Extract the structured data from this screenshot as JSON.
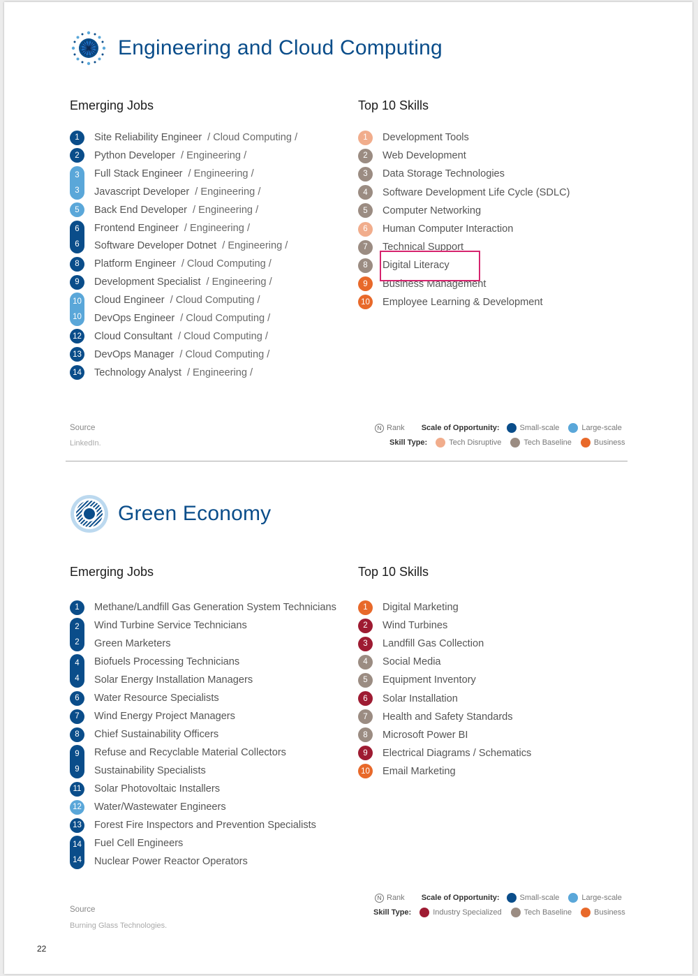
{
  "colors": {
    "title": "#0a4d8a",
    "small_scale": "#0a4d8a",
    "large_scale": "#5aa7d9",
    "tech_disruptive": "#f1ad8c",
    "tech_baseline": "#9b8c82",
    "business": "#e8692a",
    "industry_specialized": "#9e1b32",
    "highlight": "#d6246e"
  },
  "sections": [
    {
      "title": "Engineering and Cloud Computing",
      "icon": "starburst-icon",
      "jobs_heading": "Emerging Jobs",
      "skills_heading": "Top 10 Skills",
      "jobs": [
        {
          "rank": "1",
          "name": "Site Reliability Engineer",
          "category": "/ Cloud Computing /",
          "scale": "small"
        },
        {
          "rank": "2",
          "name": "Python Developer",
          "category": "/ Engineering /",
          "scale": "small"
        },
        {
          "rank": "3",
          "name": "Full Stack Engineer",
          "category": "/ Engineering /",
          "scale": "large"
        },
        {
          "rank": "3",
          "name": "Javascript Developer",
          "category": "/ Engineering /",
          "scale": "large"
        },
        {
          "rank": "5",
          "name": "Back End Developer",
          "category": "/ Engineering /",
          "scale": "large"
        },
        {
          "rank": "6",
          "name": "Frontend Engineer",
          "category": "/ Engineering /",
          "scale": "small"
        },
        {
          "rank": "6",
          "name": "Software Developer Dotnet",
          "category": "/ Engineering /",
          "scale": "small"
        },
        {
          "rank": "8",
          "name": "Platform Engineer",
          "category": "/ Cloud Computing /",
          "scale": "small"
        },
        {
          "rank": "9",
          "name": "Development Specialist",
          "category": "/ Engineering /",
          "scale": "small"
        },
        {
          "rank": "10",
          "name": "Cloud Engineer",
          "category": "/ Cloud Computing /",
          "scale": "large"
        },
        {
          "rank": "10",
          "name": "DevOps Engineer",
          "category": "/ Cloud Computing /",
          "scale": "large"
        },
        {
          "rank": "12",
          "name": "Cloud Consultant",
          "category": "/ Cloud Computing /",
          "scale": "small"
        },
        {
          "rank": "13",
          "name": "DevOps Manager",
          "category": "/ Cloud Computing /",
          "scale": "small"
        },
        {
          "rank": "14",
          "name": "Technology Analyst",
          "category": "/ Engineering /",
          "scale": "small"
        }
      ],
      "skills": [
        {
          "rank": "1",
          "name": "Development Tools",
          "type": "tech_disruptive"
        },
        {
          "rank": "2",
          "name": "Web Development",
          "type": "tech_baseline"
        },
        {
          "rank": "3",
          "name": "Data Storage Technologies",
          "type": "tech_baseline"
        },
        {
          "rank": "4",
          "name": "Software Development Life Cycle (SDLC)",
          "type": "tech_baseline"
        },
        {
          "rank": "5",
          "name": "Computer Networking",
          "type": "tech_baseline"
        },
        {
          "rank": "6",
          "name": "Human Computer Interaction",
          "type": "tech_disruptive"
        },
        {
          "rank": "7",
          "name": "Technical Support",
          "type": "tech_baseline"
        },
        {
          "rank": "8",
          "name": "Digital Literacy",
          "type": "tech_baseline"
        },
        {
          "rank": "9",
          "name": "Business Management",
          "type": "business"
        },
        {
          "rank": "10",
          "name": "Employee Learning & Development",
          "type": "business"
        }
      ],
      "source_label": "Source",
      "source_value": "LinkedIn.",
      "legend": {
        "rank_symbol": "N",
        "rank_label": "Rank",
        "scale_label": "Scale of Opportunity:",
        "small": "Small-scale",
        "large": "Large-scale",
        "skill_type_label": "Skill Type:",
        "types": [
          {
            "label": "Tech Disruptive",
            "color": "#f1ad8c"
          },
          {
            "label": "Tech Baseline",
            "color": "#9b8c82"
          },
          {
            "label": "Business",
            "color": "#e8692a"
          }
        ]
      }
    },
    {
      "title": "Green Economy",
      "icon": "target-icon",
      "jobs_heading": "Emerging Jobs",
      "skills_heading": "Top 10 Skills",
      "jobs": [
        {
          "rank": "1",
          "name": "Methane/Landfill Gas Generation System Technicians",
          "category": "",
          "scale": "small"
        },
        {
          "rank": "2",
          "name": "Wind Turbine Service Technicians",
          "category": "",
          "scale": "small"
        },
        {
          "rank": "2",
          "name": "Green Marketers",
          "category": "",
          "scale": "small"
        },
        {
          "rank": "4",
          "name": "Biofuels Processing Technicians",
          "category": "",
          "scale": "small"
        },
        {
          "rank": "4",
          "name": "Solar Energy Installation Managers",
          "category": "",
          "scale": "small"
        },
        {
          "rank": "6",
          "name": "Water Resource Specialists",
          "category": "",
          "scale": "small"
        },
        {
          "rank": "7",
          "name": "Wind Energy Project Managers",
          "category": "",
          "scale": "small"
        },
        {
          "rank": "8",
          "name": "Chief Sustainability Officers",
          "category": "",
          "scale": "small"
        },
        {
          "rank": "9",
          "name": "Refuse and Recyclable Material Collectors",
          "category": "",
          "scale": "small"
        },
        {
          "rank": "9",
          "name": "Sustainability Specialists",
          "category": "",
          "scale": "small"
        },
        {
          "rank": "11",
          "name": "Solar Photovoltaic Installers",
          "category": "",
          "scale": "small"
        },
        {
          "rank": "12",
          "name": "Water/Wastewater Engineers",
          "category": "",
          "scale": "large"
        },
        {
          "rank": "13",
          "name": "Forest Fire Inspectors and Prevention Specialists",
          "category": "",
          "scale": "small"
        },
        {
          "rank": "14",
          "name": "Fuel Cell Engineers",
          "category": "",
          "scale": "small"
        },
        {
          "rank": "14",
          "name": "Nuclear Power Reactor Operators",
          "category": "",
          "scale": "small"
        }
      ],
      "skills": [
        {
          "rank": "1",
          "name": "Digital Marketing",
          "type": "business"
        },
        {
          "rank": "2",
          "name": "Wind Turbines",
          "type": "industry_specialized"
        },
        {
          "rank": "3",
          "name": "Landfill Gas Collection",
          "type": "industry_specialized"
        },
        {
          "rank": "4",
          "name": "Social Media",
          "type": "tech_baseline"
        },
        {
          "rank": "5",
          "name": "Equipment Inventory",
          "type": "tech_baseline"
        },
        {
          "rank": "6",
          "name": "Solar Installation",
          "type": "industry_specialized"
        },
        {
          "rank": "7",
          "name": "Health and Safety Standards",
          "type": "tech_baseline"
        },
        {
          "rank": "8",
          "name": "Microsoft Power BI",
          "type": "tech_baseline"
        },
        {
          "rank": "9",
          "name": "Electrical Diagrams / Schematics",
          "type": "industry_specialized"
        },
        {
          "rank": "10",
          "name": "Email Marketing",
          "type": "business"
        }
      ],
      "source_label": "Source",
      "source_value": "Burning Glass Technologies.",
      "legend": {
        "rank_symbol": "N",
        "rank_label": "Rank",
        "scale_label": "Scale of Opportunity:",
        "small": "Small-scale",
        "large": "Large-scale",
        "skill_type_label": "Skill Type:",
        "types": [
          {
            "label": "Industry Specialized",
            "color": "#9e1b32"
          },
          {
            "label": "Tech Baseline",
            "color": "#9b8c82"
          },
          {
            "label": "Business",
            "color": "#e8692a"
          }
        ]
      }
    }
  ],
  "page_number": "22"
}
